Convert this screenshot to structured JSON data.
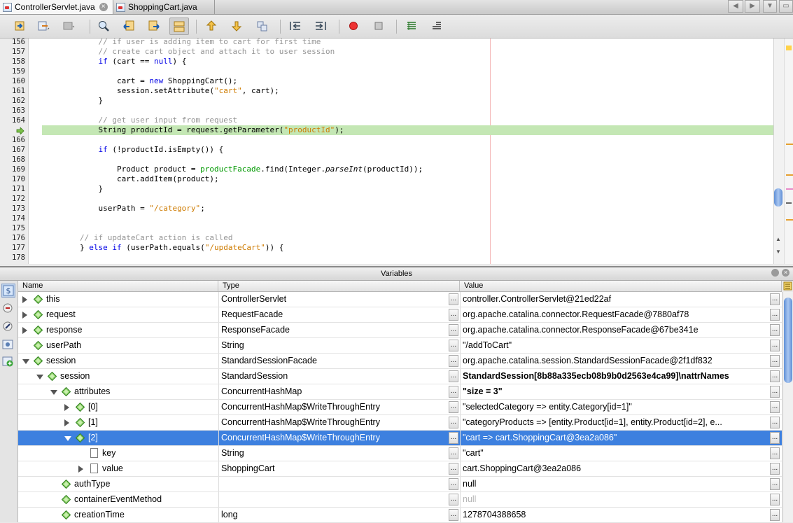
{
  "tabs": [
    {
      "label": "ControllerServlet.java",
      "active": true
    },
    {
      "label": "ShoppingCart.java",
      "active": false
    }
  ],
  "toolbar_icons": [
    "run-to-cursor-icon",
    "step-back-icon",
    "debug-action-icon",
    "search-icon",
    "back-icon",
    "forward-icon",
    "toggle-pane-icon",
    "step-over-icon",
    "step-into-icon",
    "step-out-icon",
    "rewind-icon",
    "fast-forward-icon",
    "breakpoint-icon",
    "stop-icon",
    "table-icon",
    "align-icon"
  ],
  "editor": {
    "lines": [
      {
        "num": "156",
        "segs": [
          {
            "t": "            "
          },
          {
            "t": "// if user is adding item to cart for first time",
            "c": "cm"
          }
        ]
      },
      {
        "num": "157",
        "segs": [
          {
            "t": "            "
          },
          {
            "t": "// create cart object and attach it to user session",
            "c": "cm"
          }
        ]
      },
      {
        "num": "158",
        "segs": [
          {
            "t": "            "
          },
          {
            "t": "if",
            "c": "kw"
          },
          {
            "t": " (cart == "
          },
          {
            "t": "null",
            "c": "kw"
          },
          {
            "t": ") {"
          }
        ]
      },
      {
        "num": "159",
        "segs": [
          {
            "t": ""
          }
        ]
      },
      {
        "num": "160",
        "segs": [
          {
            "t": "                cart = "
          },
          {
            "t": "new",
            "c": "kw"
          },
          {
            "t": " ShoppingCart();"
          }
        ]
      },
      {
        "num": "161",
        "segs": [
          {
            "t": "                session.setAttribute("
          },
          {
            "t": "\"cart\"",
            "c": "str"
          },
          {
            "t": ", cart);"
          }
        ]
      },
      {
        "num": "162",
        "segs": [
          {
            "t": "            }"
          }
        ]
      },
      {
        "num": "163",
        "segs": [
          {
            "t": ""
          }
        ]
      },
      {
        "num": "164",
        "segs": [
          {
            "t": "            "
          },
          {
            "t": "// get user input from request",
            "c": "cm"
          }
        ]
      },
      {
        "num": "",
        "current": true,
        "segs": [
          {
            "t": "            String productId = request.getParameter("
          },
          {
            "t": "\"productId\"",
            "c": "str"
          },
          {
            "t": ");"
          }
        ]
      },
      {
        "num": "166",
        "segs": [
          {
            "t": ""
          }
        ]
      },
      {
        "num": "167",
        "segs": [
          {
            "t": "            "
          },
          {
            "t": "if",
            "c": "kw"
          },
          {
            "t": " (!productId.isEmpty()) {"
          }
        ]
      },
      {
        "num": "168",
        "segs": [
          {
            "t": ""
          }
        ]
      },
      {
        "num": "169",
        "segs": [
          {
            "t": "                Product product = "
          },
          {
            "t": "productFacade",
            "c": "fld"
          },
          {
            "t": ".find(Integer."
          },
          {
            "t": "parseInt",
            "c": "it"
          },
          {
            "t": "(productId));"
          }
        ]
      },
      {
        "num": "170",
        "segs": [
          {
            "t": "                cart.addItem(product);"
          }
        ]
      },
      {
        "num": "171",
        "segs": [
          {
            "t": "            }"
          }
        ]
      },
      {
        "num": "172",
        "segs": [
          {
            "t": ""
          }
        ]
      },
      {
        "num": "173",
        "segs": [
          {
            "t": "            userPath = "
          },
          {
            "t": "\"/category\"",
            "c": "str"
          },
          {
            "t": ";"
          }
        ]
      },
      {
        "num": "174",
        "segs": [
          {
            "t": ""
          }
        ]
      },
      {
        "num": "175",
        "segs": [
          {
            "t": ""
          }
        ]
      },
      {
        "num": "176",
        "segs": [
          {
            "t": "        "
          },
          {
            "t": "// if updateCart action is called",
            "c": "cm"
          }
        ]
      },
      {
        "num": "177",
        "segs": [
          {
            "t": "        } "
          },
          {
            "t": "else if",
            "c": "kw"
          },
          {
            "t": " (userPath.equals("
          },
          {
            "t": "\"/updateCart\"",
            "c": "str"
          },
          {
            "t": ")) {"
          }
        ]
      },
      {
        "num": "178",
        "segs": [
          {
            "t": ""
          }
        ]
      }
    ]
  },
  "variables": {
    "title": "Variables",
    "columns": {
      "name": "Name",
      "type": "Type",
      "value": "Value"
    },
    "rows": [
      {
        "name": "this",
        "type": "ControllerServlet",
        "value": "controller.ControllerServlet@21ed22af",
        "depth": 0,
        "expander": "r",
        "icon": "gem"
      },
      {
        "name": "request",
        "type": "RequestFacade",
        "value": "org.apache.catalina.connector.RequestFacade@7880af78",
        "depth": 0,
        "expander": "r",
        "icon": "gem"
      },
      {
        "name": "response",
        "type": "ResponseFacade",
        "value": "org.apache.catalina.connector.ResponseFacade@67be341e",
        "depth": 0,
        "expander": "r",
        "icon": "gem"
      },
      {
        "name": "userPath",
        "type": "String",
        "value": "\"/addToCart\"",
        "depth": 0,
        "expander": "",
        "icon": "gem"
      },
      {
        "name": "session",
        "type": "StandardSessionFacade",
        "value": "org.apache.catalina.session.StandardSessionFacade@2f1df832",
        "depth": 0,
        "expander": "d",
        "icon": "gem"
      },
      {
        "name": "session",
        "type": "StandardSession",
        "value": "StandardSession[8b88a335ecb08b9b0d2563e4ca99]\\nattrNames",
        "depth": 1,
        "expander": "d",
        "icon": "gem",
        "bold": true
      },
      {
        "name": "attributes",
        "type": "ConcurrentHashMap",
        "value": "\"size = 3\"",
        "depth": 2,
        "expander": "d",
        "icon": "gem",
        "bold": true
      },
      {
        "name": "[0]",
        "type": "ConcurrentHashMap$WriteThroughEntry",
        "value": "\"selectedCategory => entity.Category[id=1]\"",
        "depth": 3,
        "expander": "r",
        "icon": "gem"
      },
      {
        "name": "[1]",
        "type": "ConcurrentHashMap$WriteThroughEntry",
        "value": "\"categoryProducts => [entity.Product[id=1], entity.Product[id=2], e...",
        "depth": 3,
        "expander": "r",
        "icon": "gem"
      },
      {
        "name": "[2]",
        "type": "ConcurrentHashMap$WriteThroughEntry",
        "value": "\"cart => cart.ShoppingCart@3ea2a086\"",
        "depth": 3,
        "expander": "d",
        "icon": "gem",
        "selected": true
      },
      {
        "name": "key",
        "type": "String",
        "value": "\"cart\"",
        "depth": 4,
        "expander": "",
        "icon": "doc"
      },
      {
        "name": "value",
        "type": "ShoppingCart",
        "value": "cart.ShoppingCart@3ea2a086",
        "depth": 4,
        "expander": "r",
        "icon": "doc"
      },
      {
        "name": "authType",
        "type": "",
        "value": "null",
        "depth": 2,
        "expander": "",
        "icon": "gem"
      },
      {
        "name": "containerEventMethod",
        "type": "",
        "value": "null",
        "depth": 2,
        "expander": "",
        "icon": "gem",
        "dim": true
      },
      {
        "name": "creationTime",
        "type": "long",
        "value": "1278704388658",
        "depth": 2,
        "expander": "",
        "icon": "gem"
      }
    ]
  },
  "colors": {
    "selection": "#3d80df",
    "current_line": "#c4e7b4",
    "keyword": "#0000e6",
    "string": "#ce7b00",
    "comment": "#969696"
  }
}
